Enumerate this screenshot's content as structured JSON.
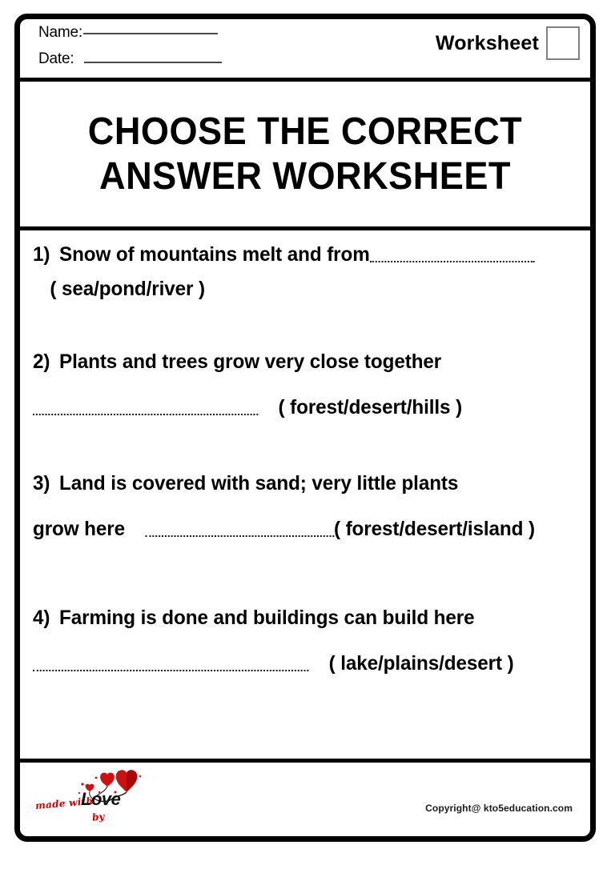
{
  "header": {
    "name_label": "Name:",
    "date_label": "Date:",
    "worksheet_label": "Worksheet",
    "worksheet_number": ""
  },
  "title": "CHOOSE THE CORRECT ANSWER WORKSHEET",
  "questions": [
    {
      "number": "1)",
      "line1": "Snow of mountains melt and from",
      "line2": "( sea/pond/river )",
      "options": [
        "sea",
        "pond",
        "river"
      ],
      "answer_value": ""
    },
    {
      "number": "2)",
      "line1": "Plants and trees grow very close together",
      "line2": "( forest/desert/hills )",
      "options": [
        "forest",
        "desert",
        "hills"
      ],
      "answer_value": ""
    },
    {
      "number": "3)",
      "line1": "Land is covered with sand; very little plants",
      "line2a": "grow here",
      "line2": "( forest/desert/island )",
      "options": [
        "forest",
        "desert",
        "island"
      ],
      "answer_value": ""
    },
    {
      "number": "4)",
      "line1": "Farming is done and buildings can build here",
      "line2": "( lake/plains/desert )",
      "options": [
        "lake",
        "plains",
        "desert"
      ],
      "answer_value": ""
    }
  ],
  "footer": {
    "logo_made": "made with",
    "logo_love": "Love",
    "logo_by": "by",
    "copyright": "Copyright@ kto5education.com"
  },
  "colors": {
    "ink": "#000000",
    "rule": "#4a4a4a",
    "box_border": "#808080",
    "heart_red": "#cc0000",
    "heart_red_dark": "#9b0000"
  }
}
